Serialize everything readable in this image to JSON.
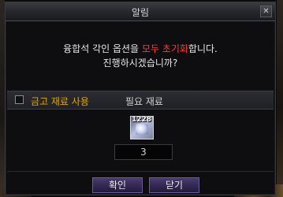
{
  "dialog": {
    "title": "알림",
    "close_glyph": "✕",
    "message": {
      "line1_prefix": "융합석 각인 옵션을 ",
      "line1_highlight": "모두 초기화",
      "line1_suffix": "합니다.",
      "line2": "진행하시겠습니까?"
    },
    "material_section": {
      "use_storage_label": "금고 재료 사용",
      "use_storage_checked": false,
      "required_label": "필요 재료"
    },
    "item": {
      "count": "1228",
      "icon": "fusion-stone-icon",
      "quantity": "3"
    },
    "buttons": {
      "confirm": "확인",
      "close": "닫기"
    }
  },
  "colors": {
    "highlight": "#ff3b2f",
    "storage_label": "#e0a400"
  }
}
